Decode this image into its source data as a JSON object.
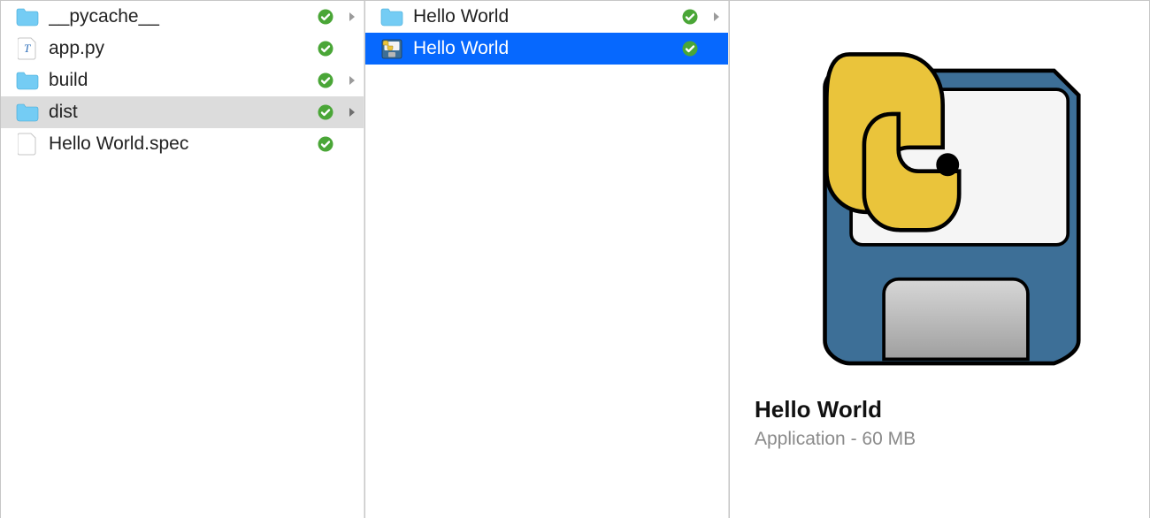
{
  "colors": {
    "selection_active": "#0668fe",
    "selection_inactive": "#dcdcdc",
    "folder": "#6fcaf2",
    "status_ok": "#4aa637"
  },
  "column1": {
    "items": [
      {
        "name": "__pycache__",
        "icon": "folder-icon",
        "status": "ok",
        "has_children": true,
        "selected": false
      },
      {
        "name": "app.py",
        "icon": "python-file-icon",
        "status": "ok",
        "has_children": false,
        "selected": false
      },
      {
        "name": "build",
        "icon": "folder-icon",
        "status": "ok",
        "has_children": true,
        "selected": false
      },
      {
        "name": "dist",
        "icon": "folder-icon",
        "status": "ok",
        "has_children": true,
        "selected": true
      },
      {
        "name": "Hello World.spec",
        "icon": "file-icon",
        "status": "ok",
        "has_children": false,
        "selected": false
      }
    ]
  },
  "column2": {
    "items": [
      {
        "name": "Hello World",
        "icon": "folder-icon",
        "status": "ok",
        "has_children": true,
        "selected": false
      },
      {
        "name": "Hello World",
        "icon": "app-icon",
        "status": "ok",
        "has_children": false,
        "selected": true
      }
    ]
  },
  "preview": {
    "title": "Hello World",
    "subtitle": "Application - 60 MB"
  }
}
